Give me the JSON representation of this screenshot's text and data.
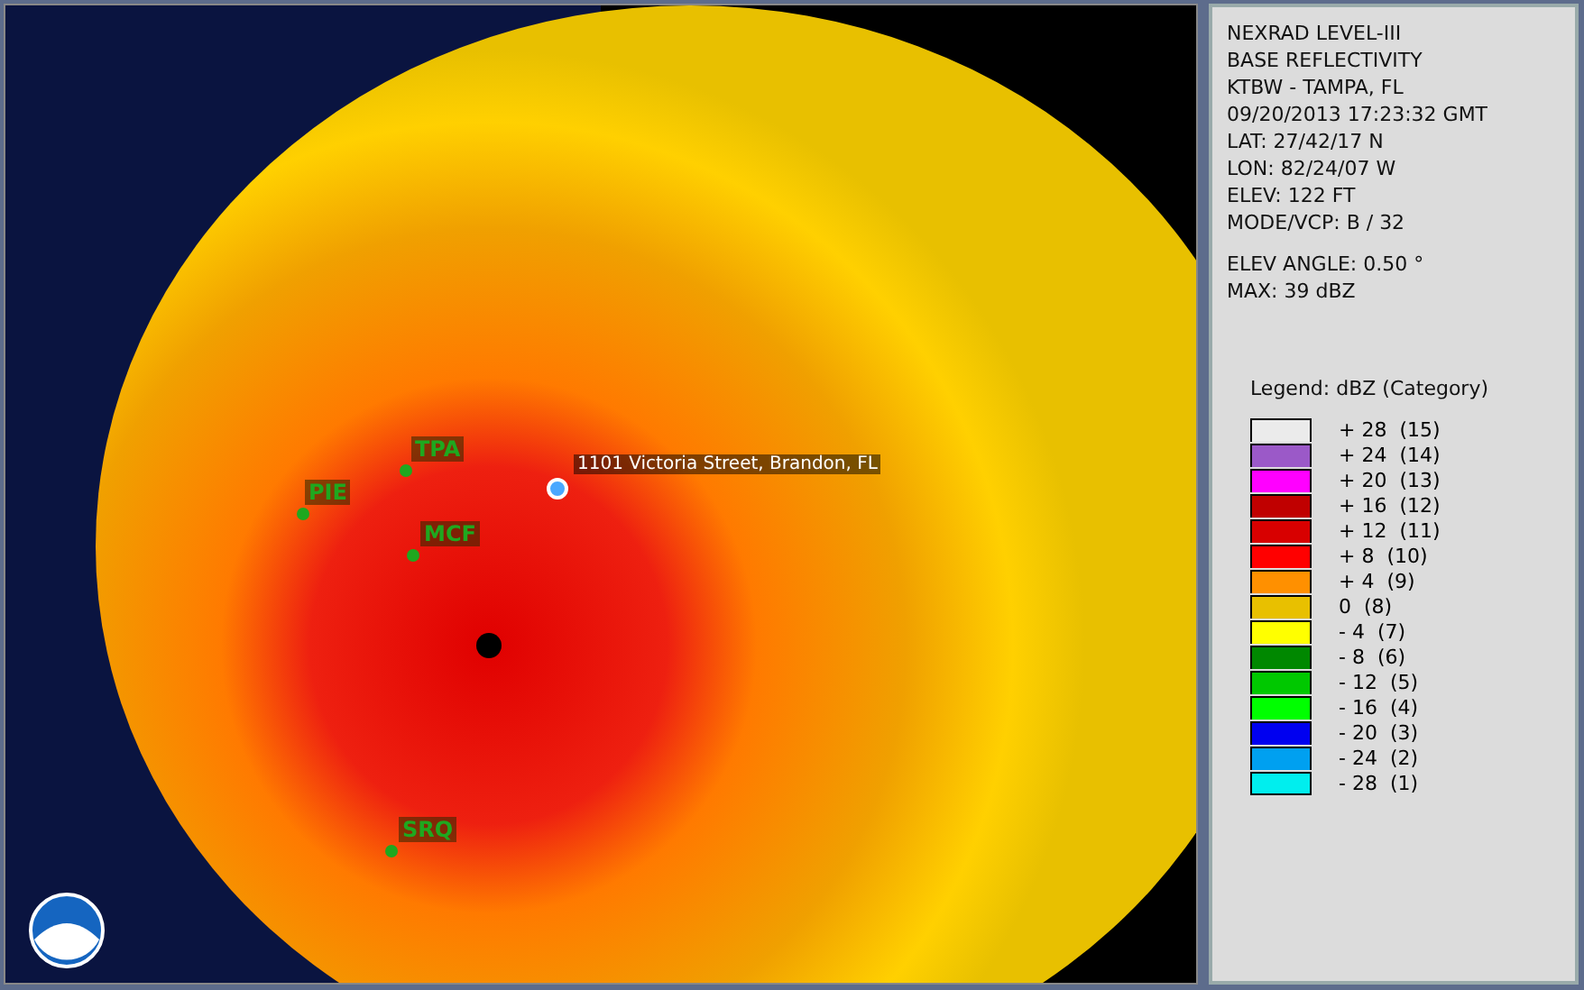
{
  "map": {
    "location_label": "1101 Victoria Street, Brandon, FL",
    "stations": [
      {
        "code": "TPA"
      },
      {
        "code": "PIE"
      },
      {
        "code": "MCF"
      },
      {
        "code": "SRQ"
      }
    ]
  },
  "panel": {
    "header_lines": [
      "NEXRAD LEVEL-III",
      "BASE REFLECTIVITY",
      "KTBW - TAMPA, FL",
      "09/20/2013 17:23:32 GMT",
      "LAT: 27/42/17 N",
      "LON: 82/24/07 W",
      "ELEV: 122 FT",
      "MODE/VCP: B / 32"
    ],
    "scan_lines": [
      "ELEV ANGLE: 0.50 °",
      "MAX: 39 dBZ"
    ],
    "legend_title": "Legend: dBZ (Category)",
    "legend": [
      {
        "value": "+ 28",
        "category": "(15)",
        "color": "#ebebeb"
      },
      {
        "value": "+ 24",
        "category": "(14)",
        "color": "#9b59c8"
      },
      {
        "value": "+ 20",
        "category": "(13)",
        "color": "#ff00ff"
      },
      {
        "value": "+ 16",
        "category": "(12)",
        "color": "#c00000"
      },
      {
        "value": "+ 12",
        "category": "(11)",
        "color": "#d80000"
      },
      {
        "value": "+ 8",
        "category": "(10)",
        "color": "#ff0000"
      },
      {
        "value": "+ 4",
        "category": "(9)",
        "color": "#ff9000"
      },
      {
        "value": "0",
        "category": "(8)",
        "color": "#e8c000"
      },
      {
        "value": "- 4",
        "category": "(7)",
        "color": "#ffff00"
      },
      {
        "value": "- 8",
        "category": "(6)",
        "color": "#008800"
      },
      {
        "value": "- 12",
        "category": "(5)",
        "color": "#00c800"
      },
      {
        "value": "- 16",
        "category": "(4)",
        "color": "#00ff00"
      },
      {
        "value": "- 20",
        "category": "(3)",
        "color": "#0000f0"
      },
      {
        "value": "- 24",
        "category": "(2)",
        "color": "#00a0f0"
      },
      {
        "value": "- 28",
        "category": "(1)",
        "color": "#00eeee"
      }
    ]
  }
}
